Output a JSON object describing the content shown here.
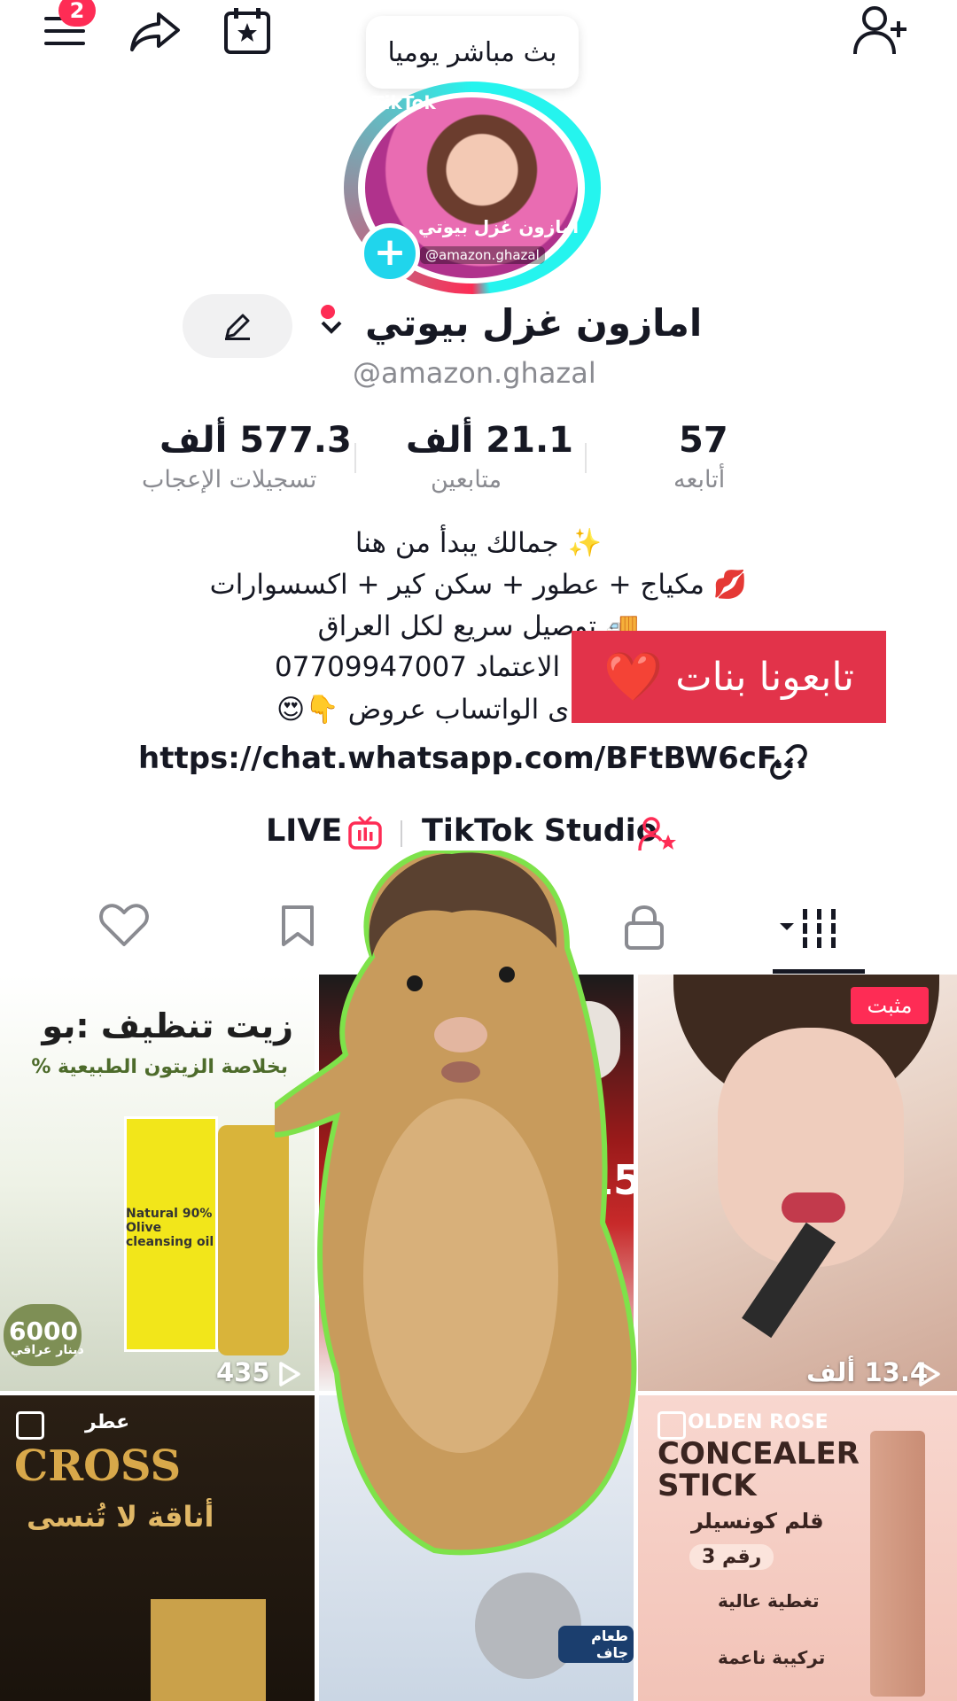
{
  "top_bar": {
    "notification_count": "2",
    "live_bubble": "بث مباشر يوميا"
  },
  "profile": {
    "avatar_name": "امازون غزل بيوتي",
    "avatar_handle": "@amazon.ghazal",
    "avatar_brand": "TikTok",
    "display_name": "امازون غزل بيوتي",
    "handle": "@amazon.ghazal"
  },
  "stats": [
    {
      "value": "57",
      "label": "أتابعه"
    },
    {
      "value": "21.1 ألف",
      "label": "متابعين"
    },
    {
      "value": "577.3 ألف",
      "label": "تسجيلات الإعجاب"
    }
  ],
  "bio": {
    "line1": "✨ جمالك يبدأ من هنا",
    "line2": "💋 مكياج + عطور + سكن كير + اكسسوارات",
    "line3": "🚚 توصيل سريع لكل العراق",
    "line4": "الاعتماد 07709947007",
    "line5": "ى الواتساب عروض 👇😍"
  },
  "follow_banner": {
    "text": "تابعونا بنات",
    "heart": "❤️"
  },
  "link": {
    "url": "https://chat.whatsapp.com/BFtBW6cF..."
  },
  "shortcuts": {
    "live": "LIVE",
    "studio": "TikTok Studio"
  },
  "grid": {
    "pinned_label": "مثبت",
    "items": [
      {
        "views": "435",
        "title": "زيت تنظيف :بو",
        "subtitle": "بخلاصة الزيتون الطبيعية %",
        "product": "Natural 90% Olive cleansing oil",
        "price": "6000",
        "price_unit": "دينار عراقي"
      },
      {
        "views": "",
        "price": "150"
      },
      {
        "views": "13.4 ألف"
      },
      {
        "title": "عطر",
        "brand": "CROSS",
        "tagline": "أناقة لا تُنسى"
      },
      {
        "label": "طعام جاف"
      },
      {
        "brand_top": "OLDEN ROSE",
        "title": "CONCEALER STICK",
        "subtitle": "قلم كونسيلر",
        "number": "رقم 3",
        "feature1": "تغطية عالية",
        "feature2": "تركيبة ناعمة"
      }
    ]
  },
  "colors": {
    "accent": "#fe2c55",
    "cyan": "#25f4ee",
    "banner": "#e2334a"
  }
}
